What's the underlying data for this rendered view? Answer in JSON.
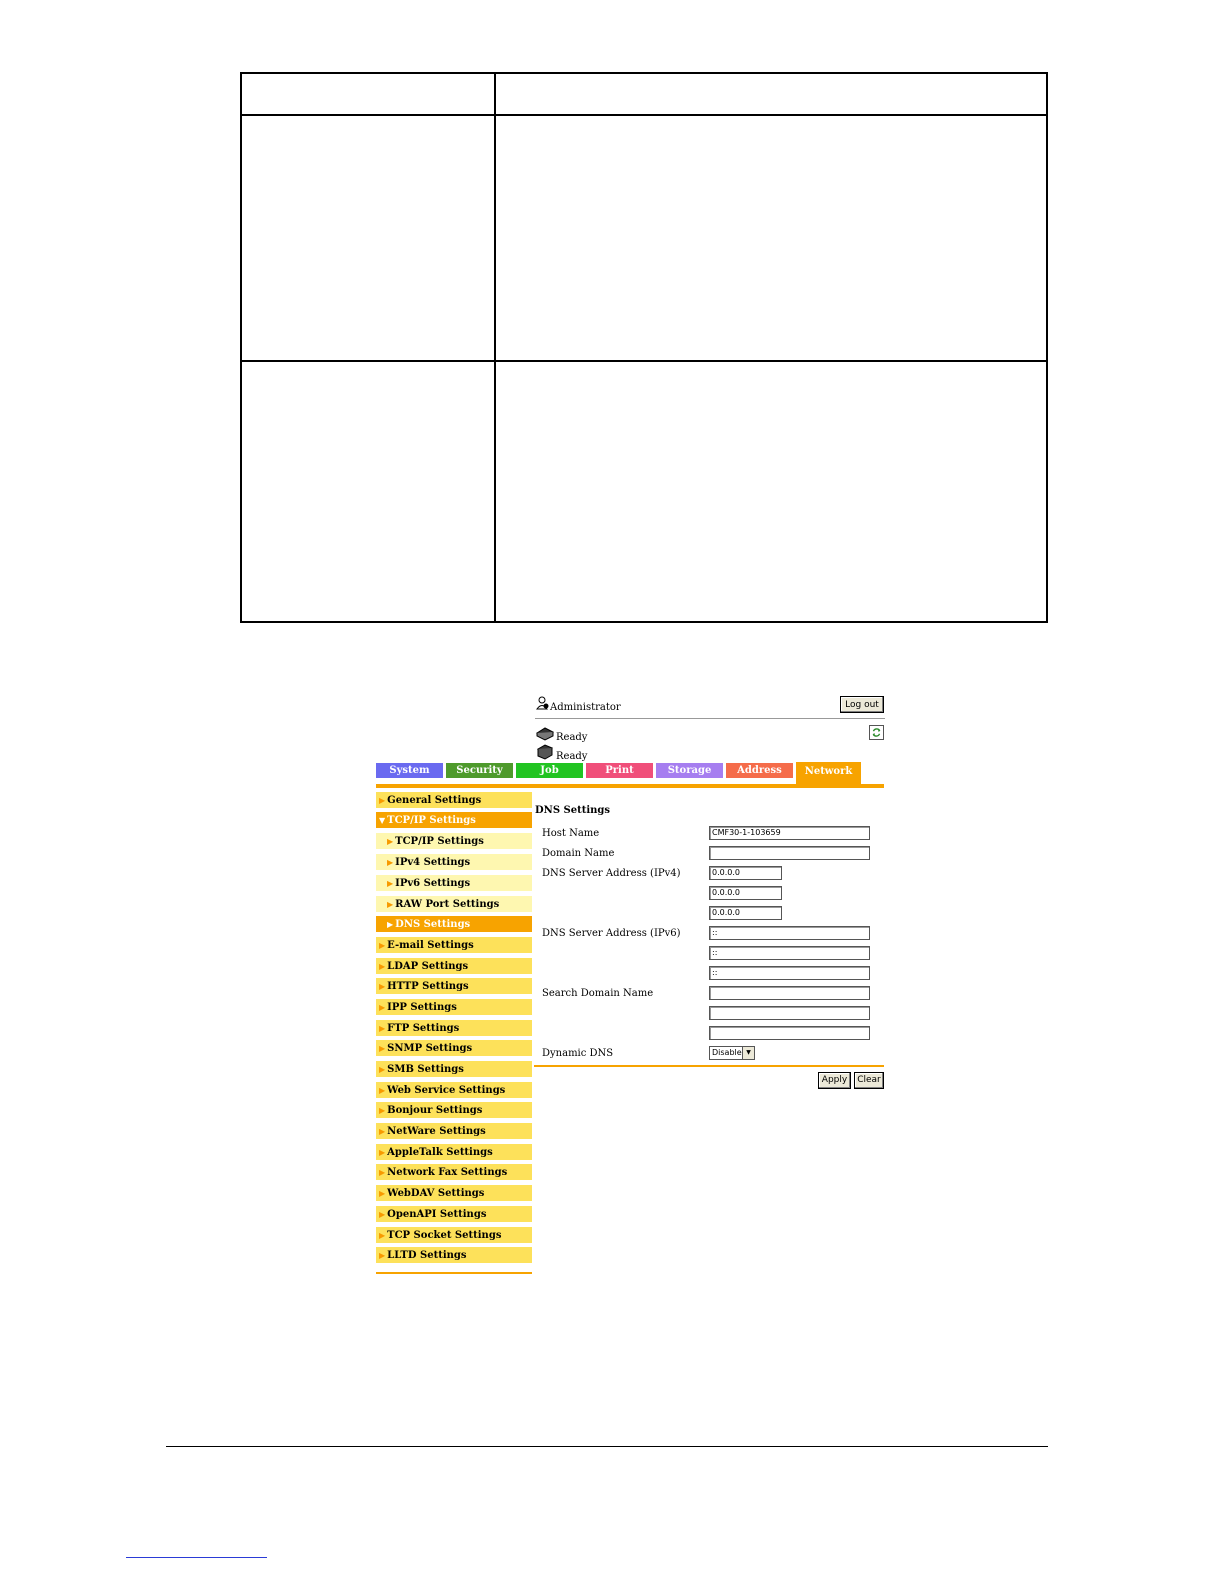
{
  "header": {
    "user_label": "Administrator",
    "logout_label": "Log out",
    "status_printer": "Ready",
    "status_scanner": "Ready"
  },
  "tabs": [
    {
      "label": "System",
      "color": "#6a6af0"
    },
    {
      "label": "Security",
      "color": "#4e9a2c"
    },
    {
      "label": "Job",
      "color": "#22c422"
    },
    {
      "label": "Print",
      "color": "#f04f7a"
    },
    {
      "label": "Storage",
      "color": "#a67ef0"
    },
    {
      "label": "Address",
      "color": "#f56c4a"
    },
    {
      "label": "Network",
      "color": "#f7a300"
    }
  ],
  "sidebar": {
    "items": [
      {
        "label": "General Settings"
      },
      {
        "label": "TCP/IP Settings"
      },
      {
        "label": "TCP/IP Settings"
      },
      {
        "label": "IPv4 Settings"
      },
      {
        "label": "IPv6 Settings"
      },
      {
        "label": "RAW Port Settings"
      },
      {
        "label": "DNS Settings"
      },
      {
        "label": "E-mail Settings"
      },
      {
        "label": "LDAP Settings"
      },
      {
        "label": "HTTP Settings"
      },
      {
        "label": "IPP Settings"
      },
      {
        "label": "FTP Settings"
      },
      {
        "label": "SNMP Settings"
      },
      {
        "label": "SMB Settings"
      },
      {
        "label": "Web Service Settings"
      },
      {
        "label": "Bonjour Settings"
      },
      {
        "label": "NetWare Settings"
      },
      {
        "label": "AppleTalk Settings"
      },
      {
        "label": "Network Fax Settings"
      },
      {
        "label": "WebDAV Settings"
      },
      {
        "label": "OpenAPI Settings"
      },
      {
        "label": "TCP Socket Settings"
      },
      {
        "label": "LLTD Settings"
      }
    ]
  },
  "main": {
    "title": "DNS Settings",
    "host_name_label": "Host Name",
    "host_name_value": "CMF30-1-103659",
    "domain_name_label": "Domain Name",
    "domain_name_value": "",
    "dns_ipv4_label": "DNS Server Address (IPv4)",
    "dns_ipv4_values": [
      "0.0.0.0",
      "0.0.0.0",
      "0.0.0.0"
    ],
    "dns_ipv6_label": "DNS Server Address (IPv6)",
    "dns_ipv6_values": [
      "::",
      "::",
      "::"
    ],
    "search_domain_label": "Search Domain Name",
    "search_domain_values": [
      "",
      "",
      ""
    ],
    "dynamic_dns_label": "Dynamic DNS",
    "dynamic_dns_value": "Disable",
    "apply_label": "Apply",
    "clear_label": "Clear"
  },
  "colors": {
    "accent": "#f7a300",
    "menu_yellow": "#fde15a",
    "submenu_yellow": "#fef7b0"
  }
}
